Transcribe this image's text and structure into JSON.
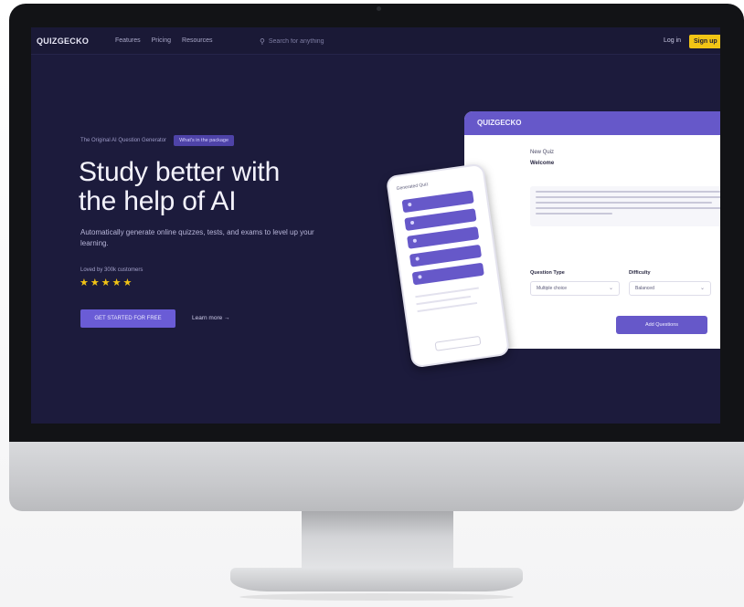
{
  "nav": {
    "logo": "QUIZGECKO",
    "links": [
      "Features",
      "Pricing",
      "Resources"
    ],
    "search_placeholder": "Search for anything",
    "login": "Log in",
    "signup": "Sign up"
  },
  "hero": {
    "badge_text": "The Original AI Question Generator",
    "badge_pill": "What's in the package",
    "headline_line1": "Study better with",
    "headline_line2": "the help of AI",
    "subtitle": "Automatically generate online quizzes, tests, and exams to level up your learning.",
    "loved_by": "Loved by 300k customers",
    "stars": "★★★★★",
    "cta": "GET STARTED FOR FREE",
    "learn_more": "Learn more →"
  },
  "card": {
    "brand": "QUIZGECKO",
    "title": "New Quiz",
    "subtitle": "Welcome",
    "select_a_label": "Question Type",
    "select_a_value": "Multiple choice",
    "select_b_label": "Difficulty",
    "select_b_value": "Balanced",
    "button": "Add Questions"
  },
  "phone": {
    "header": "Generated Quiz"
  },
  "colors": {
    "screen_bg": "#1c1b3c",
    "accent": "#6658c9",
    "signup_yellow": "#f2c415"
  }
}
